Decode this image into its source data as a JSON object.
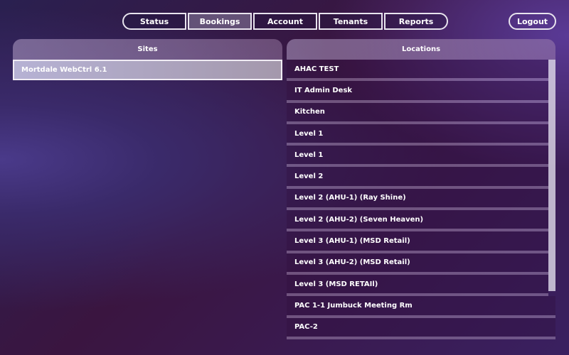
{
  "nav": {
    "tabs": [
      "Status",
      "Bookings",
      "Account",
      "Tenants",
      "Reports"
    ],
    "active": "Bookings",
    "logout": "Logout"
  },
  "sites": {
    "header": "Sites",
    "items": [
      "Mortdale WebCtrl 6.1"
    ]
  },
  "locations": {
    "header": "Locations",
    "items": [
      "AHAC TEST",
      "IT Admin Desk",
      "Kitchen",
      "Level 1",
      "Level 1",
      "Level 2",
      "Level 2 (AHU-1)  (Ray Shine)",
      "Level 2 (AHU-2) (Seven Heaven)",
      "Level 3 (AHU-1) (MSD Retail)",
      "Level 3 (AHU-2) (MSD Retail)",
      "Level 3 (MSD RETAIl)",
      "PAC 1-1 Jumbuck Meeting Rm",
      "PAC-2"
    ]
  }
}
